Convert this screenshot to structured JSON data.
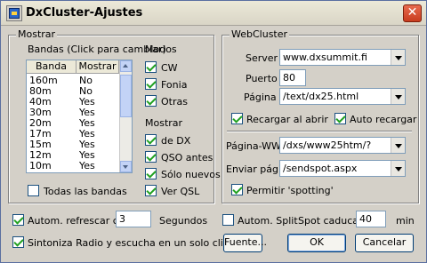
{
  "window": {
    "title": "DxCluster-Ajustes",
    "close_glyph": "✕"
  },
  "mostrar": {
    "legend": "Mostrar",
    "bandas_label": "Bandas (Click para cambiar)",
    "columns": [
      "Banda",
      "Mostrar"
    ],
    "rows": [
      [
        "160m",
        "No"
      ],
      [
        "80m",
        "No"
      ],
      [
        "40m",
        "Yes"
      ],
      [
        "30m",
        "Yes"
      ],
      [
        "20m",
        "Yes"
      ],
      [
        "17m",
        "Yes"
      ],
      [
        "15m",
        "Yes"
      ],
      [
        "12m",
        "Yes"
      ],
      [
        "10m",
        "Yes"
      ]
    ],
    "todas_label": "Todas las bandas",
    "todas_checked": false,
    "modos_label": "Modos",
    "modos": [
      {
        "label": "CW",
        "checked": true
      },
      {
        "label": "Fonia",
        "checked": true
      },
      {
        "label": "Otras",
        "checked": true
      }
    ],
    "mostrar2_label": "Mostrar",
    "mostrar2": [
      {
        "label": "de DX",
        "checked": true
      },
      {
        "label": "QSO antes",
        "checked": true
      },
      {
        "label": "Sólo nuevos",
        "checked": true
      },
      {
        "label": "Ver QSL",
        "checked": true
      }
    ]
  },
  "webcluster": {
    "legend": "WebCluster",
    "server_label": "Server",
    "server_value": "www.dxsummit.fi",
    "puerto_label": "Puerto",
    "puerto_value": "80",
    "pagina_label": "Página",
    "pagina_value": "/text/dx25.html",
    "recargar_label": "Recargar al abrir",
    "recargar_checked": true,
    "auto_label": "Auto recargar",
    "auto_checked": true,
    "paginawww_label": "Página-WWV",
    "paginawww_value": "/dxs/www25htm/?",
    "enviar_label": "Enviar página",
    "enviar_value": "/sendspot.aspx",
    "spotting_label": "Permitir 'spotting'",
    "spotting_checked": true
  },
  "bottom": {
    "autom_refresh_label": "Autom. refrescar cada",
    "autom_refresh_checked": true,
    "autom_refresh_value": "3",
    "segundos_label": "Segundos",
    "autom_split_label": "Autom. Split",
    "autom_split_checked": false,
    "spot_caduca_label": "Spot caduca",
    "spot_caduca_value": "40",
    "min_label": "min",
    "sintoniza_label": "Sintoniza Radio y escucha en un solo click",
    "sintoniza_checked": true,
    "fuente_button": "Fuente...",
    "ok_button": "OK",
    "cancel_button": "Cancelar"
  },
  "colors": {
    "accent": "#2a66c9",
    "close": "#c83c1e",
    "check": "#21a121"
  }
}
